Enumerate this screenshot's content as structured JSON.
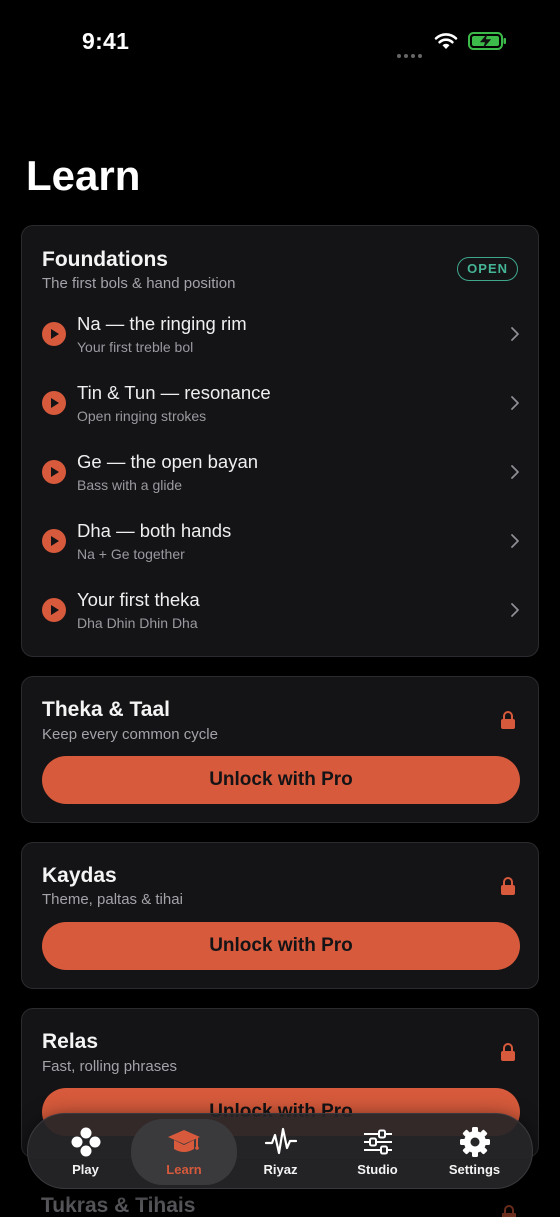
{
  "status_bar": {
    "time": "9:41"
  },
  "page": {
    "title": "Learn"
  },
  "foundations": {
    "title": "Foundations",
    "subtitle": "The first bols & hand position",
    "badge": "OPEN",
    "lessons": [
      {
        "title": "Na — the ringing rim",
        "subtitle": "Your first treble bol"
      },
      {
        "title": "Tin & Tun — resonance",
        "subtitle": "Open ringing strokes"
      },
      {
        "title": "Ge — the open bayan",
        "subtitle": "Bass with a glide"
      },
      {
        "title": "Dha — both hands",
        "subtitle": "Na + Ge together"
      },
      {
        "title": "Your first theka",
        "subtitle": "Dha Dhin Dhin Dha"
      }
    ]
  },
  "locked_sections": [
    {
      "title": "Theka & Taal",
      "subtitle": "Keep every common cycle",
      "button": "Unlock with Pro"
    },
    {
      "title": "Kaydas",
      "subtitle": "Theme, paltas & tihai",
      "button": "Unlock with Pro"
    },
    {
      "title": "Relas",
      "subtitle": "Fast, rolling phrases",
      "button": "Unlock with Pro"
    }
  ],
  "peek_section": {
    "title": "Tukras & Tihais"
  },
  "tabbar": {
    "items": [
      {
        "label": "Play",
        "icon": "dots-icon"
      },
      {
        "label": "Learn",
        "icon": "graduation-cap-icon"
      },
      {
        "label": "Riyaz",
        "icon": "waveform-icon"
      },
      {
        "label": "Studio",
        "icon": "sliders-icon"
      },
      {
        "label": "Settings",
        "icon": "gear-icon"
      }
    ],
    "active": "Learn"
  },
  "colors": {
    "accent": "#d65a3b",
    "open_badge": "#45b596",
    "card_bg": "#141316"
  }
}
